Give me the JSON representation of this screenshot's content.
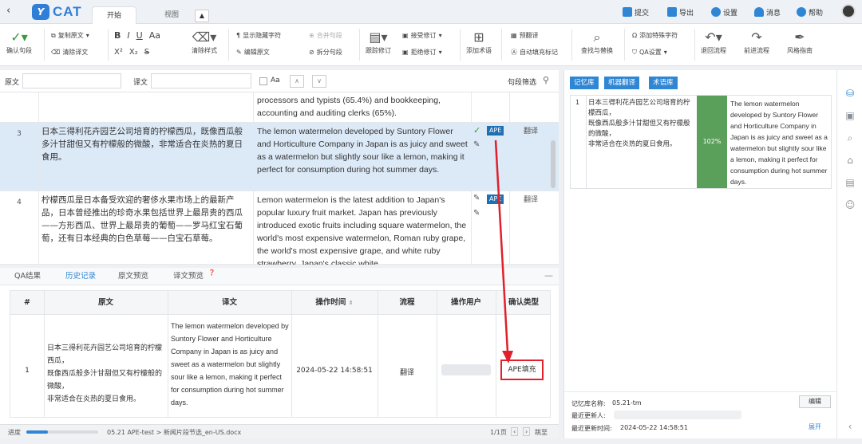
{
  "tabs": {
    "start": "开始",
    "view": "视图"
  },
  "topright": {
    "submit": "提交",
    "export": "导出",
    "settings": "设置",
    "messages": "消息",
    "help": "帮助"
  },
  "ribbon": {
    "confirm": "确认句段",
    "copy_source": "复制原文",
    "clear_target": "清除译文",
    "clear_style": "清除样式",
    "show_hidden": "显示隐藏字符",
    "edit_source": "编辑原文",
    "merge_seg": "合并句段",
    "split_seg": "拆分句段",
    "track_changes": "跟踪修订",
    "accept": "接受修订",
    "reject": "拒绝修订",
    "add_term": "添加术语",
    "pretranslate": "预翻译",
    "autofill": "自动填充标记",
    "find_replace": "查找与替换",
    "add_special": "添加特殊字符",
    "qa_settings": "QA设置",
    "back_flow": "退回流程",
    "forward_flow": "前进流程",
    "style_guide": "风格指南",
    "fmt": {
      "bold": "B",
      "italic": "I",
      "underline": "U",
      "fontsize": "Aa",
      "super": "X²",
      "sub": "X₂",
      "strike": "S"
    }
  },
  "filter": {
    "source_label": "原文",
    "target_label": "译文",
    "case": "Aa",
    "seg_filter": "句段筛选"
  },
  "segments": [
    {
      "num": "",
      "source": "",
      "target": "processors and typists (65.4%) and bookkeeping, accounting and auditing clerks (65%).",
      "status": "",
      "state": ""
    },
    {
      "num": "3",
      "source": "日本三得利花卉园艺公司培育的柠檬西瓜，既像西瓜般多汁甘甜但又有柠檬般的微酸，非常适合在炎热的夏日食用。",
      "target": "The lemon watermelon developed by Suntory Flower and Horticulture Company in Japan is as juicy and sweet as a watermelon but slightly sour like a lemon, making it perfect for consumption during hot summer days.",
      "status": "APE",
      "state": "翻译"
    },
    {
      "num": "4",
      "source": "柠檬西瓜是日本备受欢迎的奢侈水果市场上的最新产品，日本曾经推出的珍奇水果包括世界上最昂贵的西瓜——方形西瓜、世界上最昂贵的葡萄——罗马红宝石葡萄，还有日本经典的白色草莓——白宝石草莓。",
      "target": "Lemon watermelon is the latest addition to Japan's popular luxury fruit market. Japan has previously introduced exotic fruits including square watermelon, the world's most expensive watermelon, Roman ruby grape, the world's most expensive grape, and white ruby strawberry, Japan's classic white",
      "status": "APE",
      "state": "翻译"
    }
  ],
  "bottom": {
    "tabs": [
      "QA结果",
      "历史记录",
      "原文预览",
      "译文预览"
    ],
    "headers": [
      "#",
      "原文",
      "译文",
      "操作时间",
      "流程",
      "操作用户",
      "确认类型"
    ],
    "row": {
      "num": "1",
      "source": "日本三得利花卉园艺公司培育的柠檬西瓜，\n既像西瓜般多汁甘甜但又有柠檬般的微酸，\n非常适合在炎热的夏日食用。",
      "target": "The lemon watermelon developed by Suntory Flower and Horticulture Company in Japan is as juicy and sweet as a watermelon but slightly sour like a lemon, making it perfect for consumption during hot summer days.",
      "time": "2024-05-22 14:58:51",
      "flow": "翻译",
      "user": "",
      "type": "APE填充"
    }
  },
  "status": {
    "progress_label": "进度",
    "progress": 0.3,
    "task": "05.21 APE-test > 新闻片段节选_en-US.docx",
    "page": "1/1页",
    "jump": "跳至"
  },
  "right": {
    "tabs": [
      "记忆库",
      "机器翻译",
      "术语库"
    ],
    "tm": {
      "num": "1",
      "source": "日本三得利花卉园艺公司培育的柠檬西瓜，\n既像西瓜般多汁甘甜但又有柠檬般的微酸，\n非常适合在炎热的夏日食用。",
      "match": "102%",
      "target": "The lemon watermelon developed by Suntory Flower and Horticulture Company in Japan is as juicy and sweet as a watermelon but slightly sour like a lemon, making it perfect for consumption during hot summer days."
    },
    "meta": {
      "tm_name_label": "记忆库名称:",
      "tm_name": "05.21-tm",
      "updated_by_label": "最近更新人:",
      "updated_time_label": "最近更新时间:",
      "updated_time": "2024-05-22 14:58:51",
      "edit": "编辑",
      "expand": "展开"
    }
  },
  "colors": {
    "accent": "#2f86d4",
    "match_green": "#5aa05a",
    "arrow_red": "#e0202a",
    "highlight_row": "#dce9f7"
  }
}
